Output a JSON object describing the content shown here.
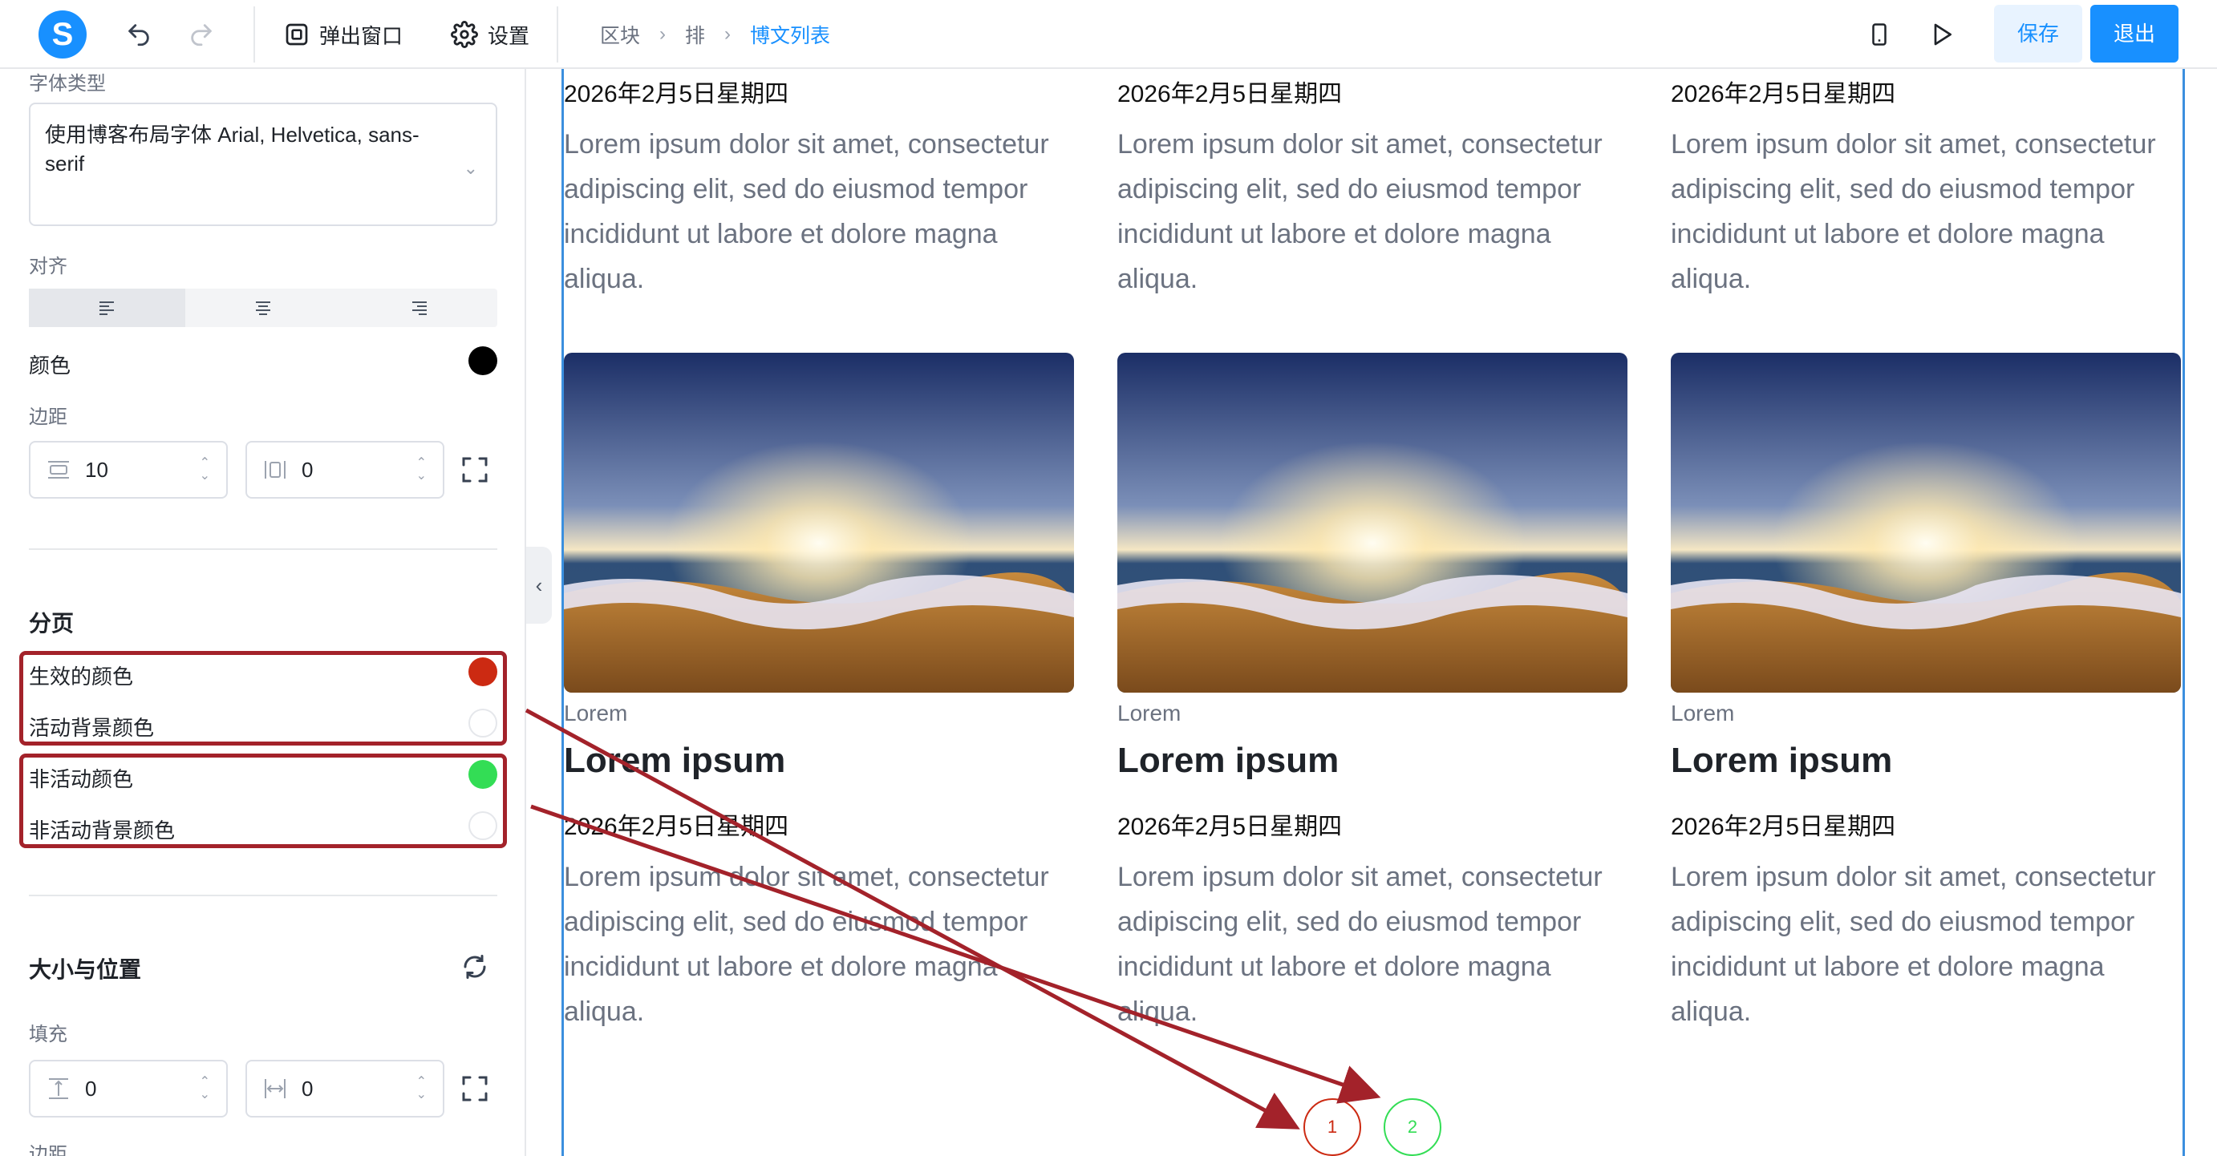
{
  "header": {
    "popup_label": "弹出窗口",
    "settings_label": "设置",
    "breadcrumb": [
      "区块",
      "排",
      "博文列表"
    ],
    "save_label": "保存",
    "exit_label": "退出",
    "accent": "#1890ff"
  },
  "panel": {
    "font_type_label": "字体类型",
    "font_type_value": "使用博客布局字体 Arial, Helvetica, sans-serif",
    "align_label": "对齐",
    "color_label": "颜色",
    "color_value": "#000000",
    "margin_label": "边距",
    "margin_vertical": "10",
    "margin_horizontal": "0",
    "pagination_title": "分页",
    "active_color_label": "生效的颜色",
    "active_color": "#cc2a12",
    "active_bg_label": "活动背景颜色",
    "inactive_color_label": "非活动颜色",
    "inactive_color": "#33dd55",
    "inactive_bg_label": "非活动背景颜色",
    "size_position_title": "大小与位置",
    "padding_label": "填充",
    "padding_vertical": "0",
    "padding_horizontal": "0",
    "margin2_label": "边距"
  },
  "posts_top": [
    {
      "date": "2026年2月5日星期四",
      "excerpt": "Lorem ipsum dolor sit amet, consectetur adipiscing elit, sed do eiusmod tempor incididunt ut labore et dolore magna aliqua."
    },
    {
      "date": "2026年2月5日星期四",
      "excerpt": "Lorem ipsum dolor sit amet, consectetur adipiscing elit, sed do eiusmod tempor incididunt ut labore et dolore magna aliqua."
    },
    {
      "date": "2026年2月5日星期四",
      "excerpt": "Lorem ipsum dolor sit amet, consectetur adipiscing elit, sed do eiusmod tempor incididunt ut labore et dolore magna aliqua."
    }
  ],
  "posts": [
    {
      "category": "Lorem",
      "title": "Lorem ipsum",
      "date": "2026年2月5日星期四",
      "excerpt": "Lorem ipsum dolor sit amet, consectetur adipiscing elit, sed do eiusmod tempor incididunt ut labore et dolore magna aliqua."
    },
    {
      "category": "Lorem",
      "title": "Lorem ipsum",
      "date": "2026年2月5日星期四",
      "excerpt": "Lorem ipsum dolor sit amet, consectetur adipiscing elit, sed do eiusmod tempor incididunt ut labore et dolore magna aliqua."
    },
    {
      "category": "Lorem",
      "title": "Lorem ipsum",
      "date": "2026年2月5日星期四",
      "excerpt": "Lorem ipsum dolor sit amet, consectetur adipiscing elit, sed do eiusmod tempor incididunt ut labore et dolore magna aliqua."
    }
  ],
  "pagination": {
    "pages": [
      "1",
      "2"
    ],
    "active_color": "#cc2a12",
    "inactive_color": "#33dd55"
  },
  "annotation_color": "#a3222a"
}
